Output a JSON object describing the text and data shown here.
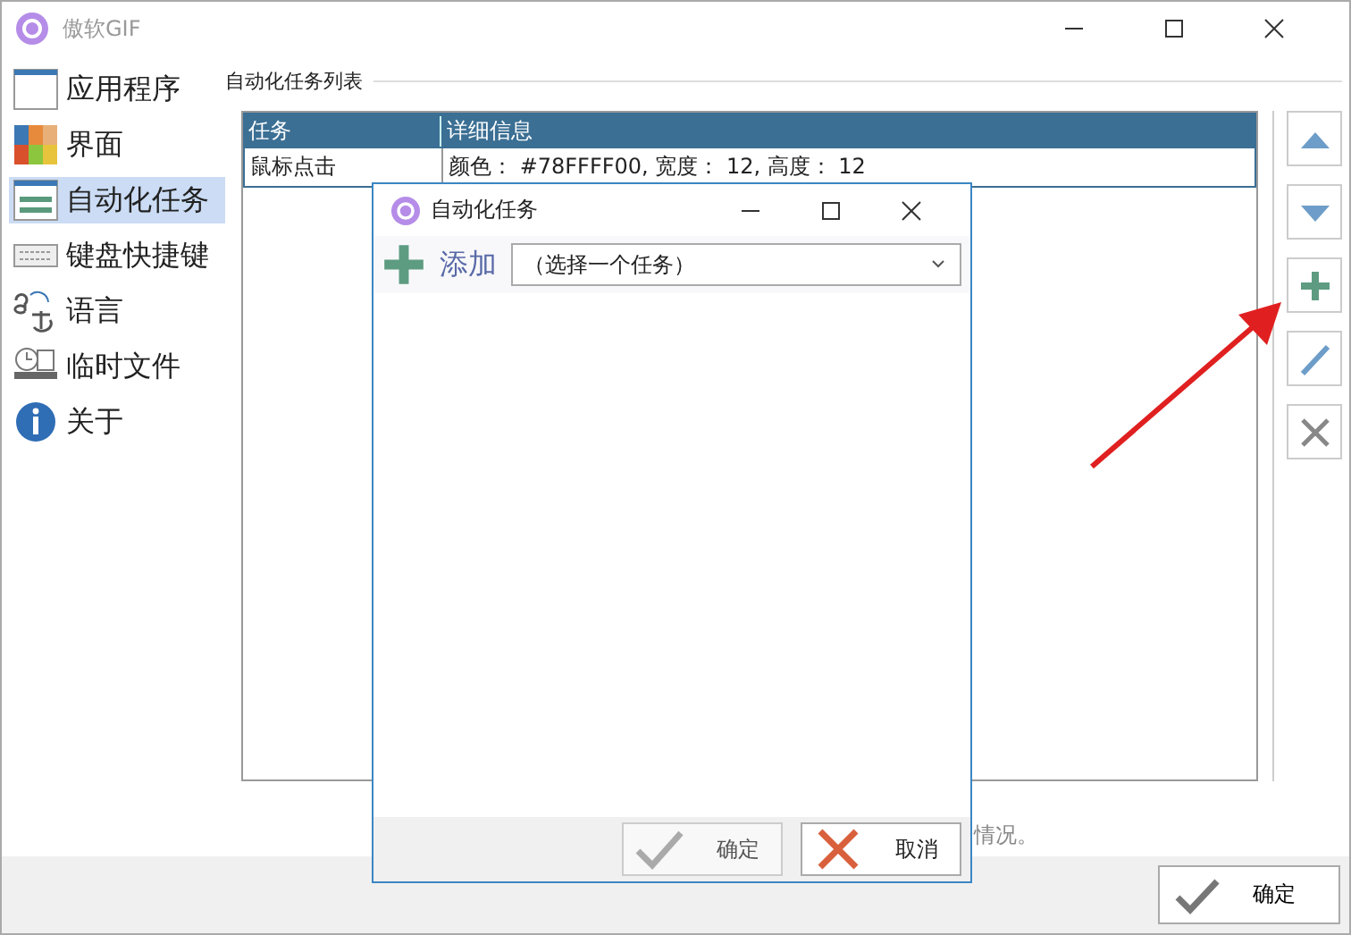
{
  "window": {
    "title": "傲软GIF"
  },
  "sidebar": {
    "items": [
      {
        "kind": "app",
        "label": "应用程序",
        "selected": false
      },
      {
        "kind": "ui",
        "label": "界面",
        "selected": false
      },
      {
        "kind": "auto",
        "label": "自动化任务",
        "selected": true
      },
      {
        "kind": "keyboard",
        "label": "键盘快捷键",
        "selected": false
      },
      {
        "kind": "language",
        "label": "语言",
        "selected": false
      },
      {
        "kind": "temp",
        "label": "临时文件",
        "selected": false
      },
      {
        "kind": "about",
        "label": "关于",
        "selected": false
      }
    ]
  },
  "group": {
    "title": "自动化任务列表"
  },
  "table": {
    "columns": [
      "任务",
      "详细信息"
    ],
    "rows": [
      [
        "鼠标点击",
        "颜色： #78FFFF00, 宽度： 12, 高度： 12"
      ]
    ]
  },
  "toolbar": [
    {
      "kind": "up"
    },
    {
      "kind": "down"
    },
    {
      "kind": "add"
    },
    {
      "kind": "edit"
    },
    {
      "kind": "delete"
    }
  ],
  "hint": "情况。",
  "ok_button": "确定",
  "dialog": {
    "title": "自动化任务",
    "add_label": "添加",
    "dropdown": "（选择一个任务）",
    "buttons": [
      {
        "kind": "ok",
        "label": "确定",
        "disabled": true
      },
      {
        "kind": "cancel",
        "label": "取消",
        "disabled": false
      }
    ]
  }
}
